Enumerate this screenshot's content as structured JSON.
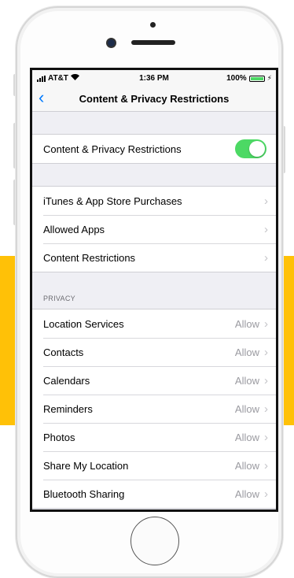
{
  "status_bar": {
    "carrier": "AT&T",
    "time": "1:36 PM",
    "battery_pct": "100%",
    "icons": [
      "signal-icon",
      "wifi-icon",
      "battery-icon",
      "charging-bolt-icon"
    ]
  },
  "nav": {
    "back_icon": "chevron-left-icon",
    "title": "Content & Privacy Restrictions"
  },
  "master": {
    "label": "Content & Privacy Restrictions",
    "enabled": true
  },
  "store_group": [
    {
      "label": "iTunes & App Store Purchases"
    },
    {
      "label": "Allowed Apps"
    },
    {
      "label": "Content Restrictions"
    }
  ],
  "privacy": {
    "header": "PRIVACY",
    "items": [
      {
        "label": "Location Services",
        "value": "Allow"
      },
      {
        "label": "Contacts",
        "value": "Allow"
      },
      {
        "label": "Calendars",
        "value": "Allow"
      },
      {
        "label": "Reminders",
        "value": "Allow"
      },
      {
        "label": "Photos",
        "value": "Allow"
      },
      {
        "label": "Share My Location",
        "value": "Allow"
      },
      {
        "label": "Bluetooth Sharing",
        "value": "Allow"
      }
    ]
  },
  "colors": {
    "accent_yellow": "#FFC107",
    "ios_blue": "#007aff",
    "toggle_green": "#4cd964"
  }
}
